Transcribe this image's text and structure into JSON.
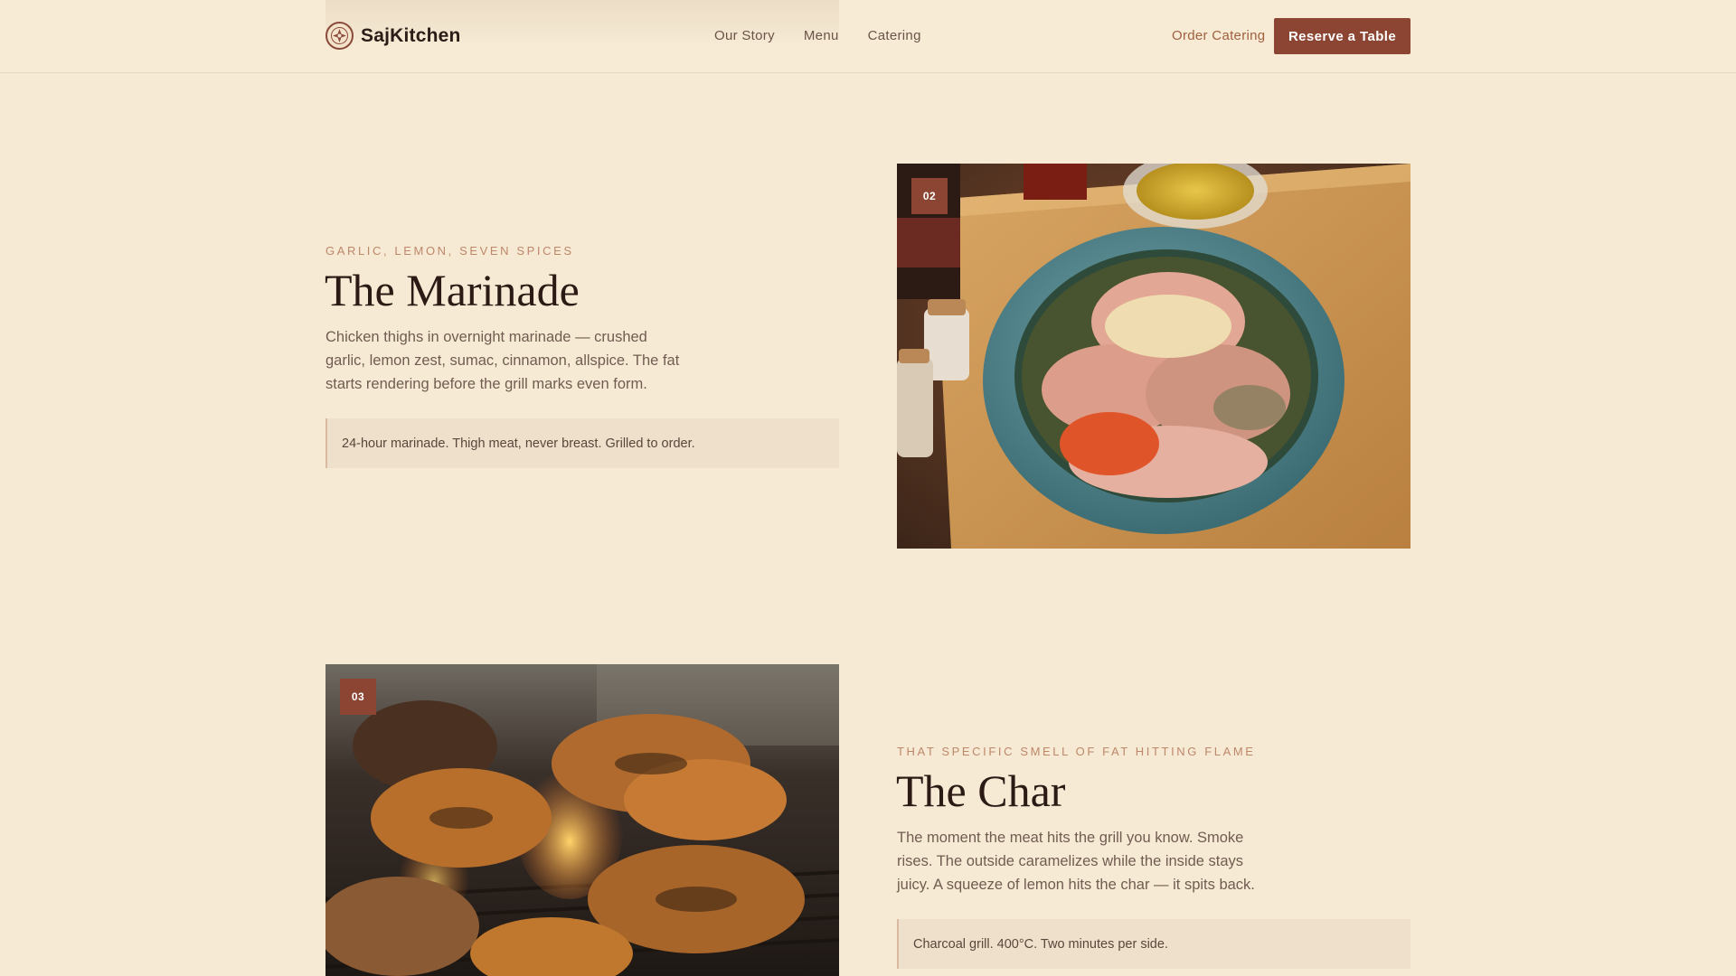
{
  "header": {
    "brand": "SajKitchen",
    "nav": [
      "Our Story",
      "Menu",
      "Catering"
    ],
    "order_link": "Order Catering",
    "reserve_button": "Reserve a Table"
  },
  "sections": [
    {
      "badge": "02",
      "eyebrow": "GARLIC, LEMON, SEVEN SPICES",
      "title": "The Marinade",
      "description": "Chicken thighs in overnight marinade — crushed garlic, lemon zest, sumac, cinnamon, allspice. The fat starts rendering before the grill marks even form.",
      "note": "24-hour marinade. Thigh meat, never breast. Grilled to order."
    },
    {
      "badge": "03",
      "eyebrow": "THAT SPECIFIC SMELL OF FAT HITTING FLAME",
      "title": "The Char",
      "description": "The moment the meat hits the grill you know. Smoke rises. The outside caramelizes while the inside stays juicy. A squeeze of lemon hits the char — it spits back.",
      "note": "Charcoal grill. 400°C. Two minutes per side."
    }
  ]
}
